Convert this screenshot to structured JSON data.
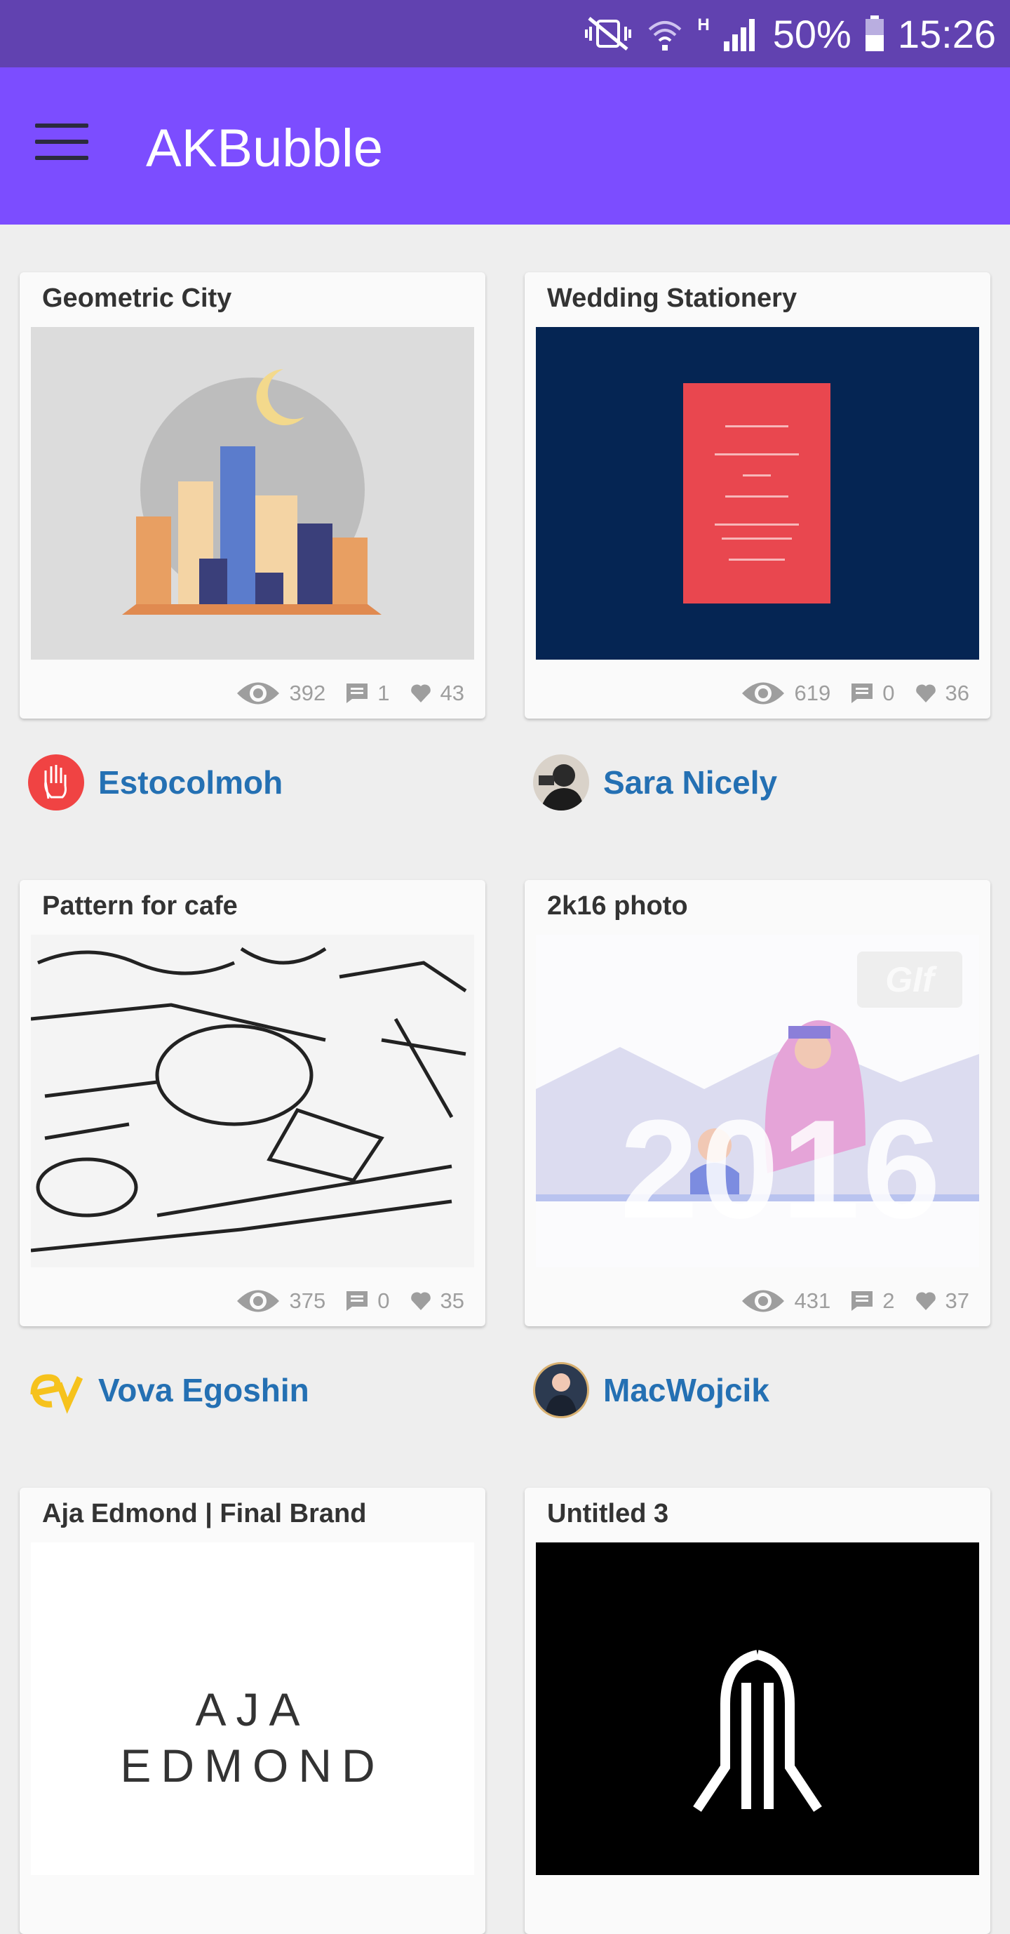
{
  "status_bar": {
    "battery": "50%",
    "time": "15:26",
    "network": "H"
  },
  "app": {
    "title": "AKBubble"
  },
  "shots": [
    {
      "title": "Geometric City",
      "views": "392",
      "comments": "1",
      "likes": "43",
      "author": "Estocolmoh"
    },
    {
      "title": "Wedding Stationery",
      "views": "619",
      "comments": "0",
      "likes": "36",
      "author": "Sara Nicely"
    },
    {
      "title": "Pattern for cafe",
      "views": "375",
      "comments": "0",
      "likes": "35",
      "author": "Vova Egoshin"
    },
    {
      "title": "2k16 photo",
      "views": "431",
      "comments": "2",
      "likes": "37",
      "author": "MacWojcik",
      "badge": "GIf",
      "art_text": "2016"
    },
    {
      "title": "Aja Edmond | Final Brand",
      "art_text_1": "AJA",
      "art_text_2": "EDMOND"
    },
    {
      "title": "Untitled 3"
    }
  ],
  "colors": {
    "status": "#6142b0",
    "appbar": "#7c4dff",
    "author": "#2470b3"
  },
  "icons": [
    "mute-vibrate-icon",
    "wifi-icon",
    "signal-icon",
    "battery-icon",
    "menu-icon",
    "eye-icon",
    "comment-icon",
    "heart-icon"
  ]
}
